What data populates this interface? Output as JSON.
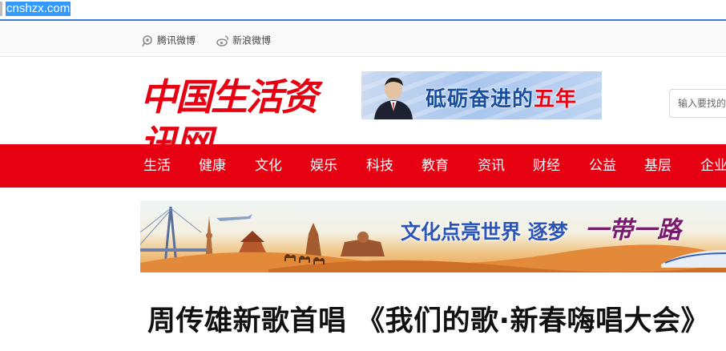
{
  "address_bar": {
    "url": "cnshzx.com"
  },
  "top_links": [
    {
      "label": "腾讯微博",
      "icon": "tencent-weibo-icon"
    },
    {
      "label": "新浪微博",
      "icon": "sina-weibo-icon"
    }
  ],
  "header": {
    "logo_text": "中国生活资讯网",
    "banner1": {
      "text_main": "砥砺奋进的",
      "text_highlight": "五年"
    },
    "search": {
      "placeholder": "输入要找的"
    }
  },
  "nav": {
    "items": [
      "生活",
      "健康",
      "文化",
      "娱乐",
      "科技",
      "教育",
      "资讯",
      "财经",
      "公益",
      "基层",
      "企业"
    ]
  },
  "banner2": {
    "text": "文化点亮世界  逐梦",
    "calligraphy": "一带一路"
  },
  "article": {
    "headline": "周传雄新歌首唱 《我们的歌·新春嗨唱大会》"
  },
  "colors": {
    "brand_red": "#e60012",
    "url_highlight": "#3399ff",
    "banner_blue": "#2b55b7"
  }
}
